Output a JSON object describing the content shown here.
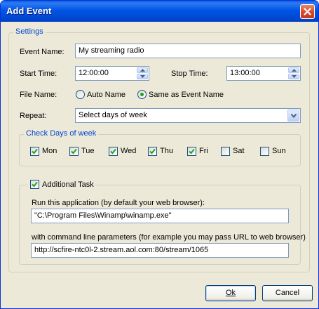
{
  "window": {
    "title": "Add Event"
  },
  "settings": {
    "legend": "Settings",
    "event_name_label": "Event Name:",
    "event_name_value": "My streaming radio",
    "start_time_label": "Start Time:",
    "start_time_value": "12:00:00",
    "stop_time_label": "Stop Time:",
    "stop_time_value": "13:00:00",
    "file_name_label": "File Name:",
    "file_name_options": [
      "Auto Name",
      "Same as Event Name"
    ],
    "file_name_selected": "Same as Event Name",
    "repeat_label": "Repeat:",
    "repeat_value": "Select days of week"
  },
  "days": {
    "legend": "Check Days of week",
    "items": [
      {
        "label": "Mon",
        "checked": true
      },
      {
        "label": "Tue",
        "checked": true
      },
      {
        "label": "Wed",
        "checked": true
      },
      {
        "label": "Thu",
        "checked": true
      },
      {
        "label": "Fri",
        "checked": true
      },
      {
        "label": "Sat",
        "checked": false
      },
      {
        "label": "Sun",
        "checked": false
      }
    ]
  },
  "task": {
    "label": "Additional Task",
    "checked": true,
    "app_label": "Run this application (by default your web browser):",
    "app_value": "\"C:\\Program Files\\Winamp\\winamp.exe\"",
    "params_label": "with command line parameters (for example you may pass URL to web browser)",
    "params_value": "http://scfire-ntc0l-2.stream.aol.com:80/stream/1065"
  },
  "buttons": {
    "ok": "Ok",
    "cancel": "Cancel"
  },
  "colors": {
    "title_bar": "#0055E5",
    "dialog_bg": "#ECE9D8",
    "legend_text": "#0046D5",
    "check_mark": "#21A121",
    "close_button": "#D6492A"
  },
  "icons": {
    "close": "close-x-icon",
    "spin_up": "arrow-up-icon",
    "spin_down": "arrow-down-icon",
    "dropdown": "chevron-down-icon",
    "check": "check-icon"
  }
}
